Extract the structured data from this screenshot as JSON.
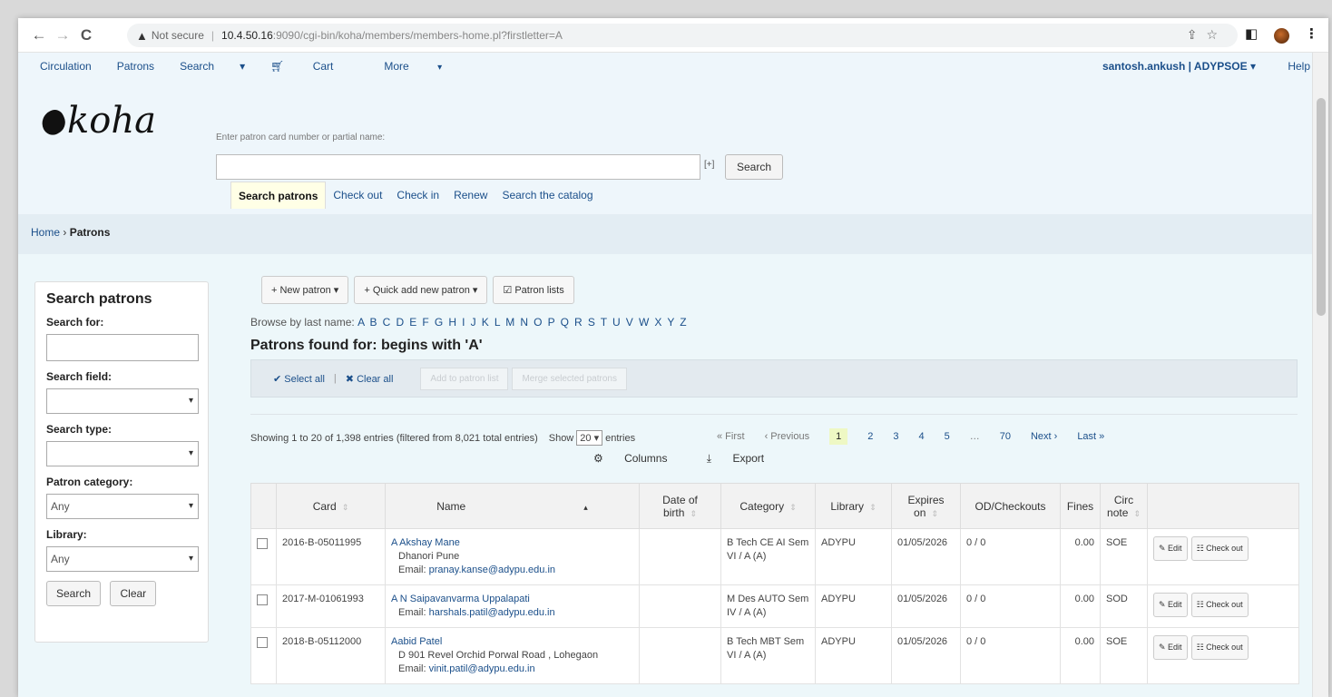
{
  "browser": {
    "security": "Not secure",
    "host": "10.4.50.16",
    "path": ":9090/cgi-bin/koha/members/members-home.pl?firstletter=A"
  },
  "topnav": {
    "items": [
      "Circulation",
      "Patrons",
      "Search",
      "Cart",
      "More"
    ],
    "user": "santosh.ankush",
    "branch": "ADYPSOE",
    "help": "Help"
  },
  "logo": "koha",
  "search": {
    "label": "Enter patron card number or partial name:",
    "plus": "[+]",
    "button": "Search",
    "tabs": [
      "Search patrons",
      "Check out",
      "Check in",
      "Renew",
      "Search the catalog"
    ]
  },
  "breadcrumb": {
    "home": "Home",
    "current": "Patrons"
  },
  "sidebar": {
    "title": "Search patrons",
    "search_for": "Search for:",
    "search_field": "Search field:",
    "search_type": "Search type:",
    "patron_category": "Patron category:",
    "category_value": "Any",
    "library": "Library:",
    "library_value": "Any",
    "search_btn": "Search",
    "clear_btn": "Clear"
  },
  "toolbar": {
    "new_patron": "New patron",
    "quick_add": "Quick add new patron",
    "patron_lists": "Patron lists"
  },
  "browse": {
    "label": "Browse by last name:",
    "letters": "A B C D E F G H I J K L M N O P Q R S T U V W X Y Z"
  },
  "found_title": "Patrons found for: begins with 'A'",
  "selection": {
    "select_all": "Select all",
    "clear_all": "Clear all",
    "add_to_list": "Add to patron list",
    "merge": "Merge selected patrons"
  },
  "listing": {
    "showing": "Showing 1 to 20 of 1,398 entries (filtered from 8,021 total entries)",
    "show": "Show",
    "per_page": "20",
    "entries": "entries",
    "first": "« First",
    "previous": "‹ Previous",
    "pages": [
      "1",
      "2",
      "3",
      "4",
      "5",
      "…",
      "70"
    ],
    "next": "Next ›",
    "last": "Last »",
    "columns": "Columns",
    "export": "Export"
  },
  "table": {
    "headers": [
      "Card",
      "Name",
      "Date of birth",
      "Category",
      "Library",
      "Expires on",
      "OD/Checkouts",
      "Fines",
      "Circ note"
    ],
    "edit": "Edit",
    "checkout": "Check out",
    "rows": [
      {
        "card": "2016-B-05011995",
        "name": "A Akshay Mane",
        "addr": "Dhanori Pune",
        "email_label": "Email:",
        "email": "pranay.kanse@adypu.edu.in",
        "dob": "",
        "category": "B Tech CE AI Sem VI / A (A)",
        "library": "ADYPU",
        "expires": "01/05/2026",
        "od": "0 / 0",
        "fines": "0.00",
        "note": "SOE"
      },
      {
        "card": "2017-M-01061993",
        "name": "A N Saipavanvarma Uppalapati",
        "addr": "",
        "email_label": "Email:",
        "email": "harshals.patil@adypu.edu.in",
        "dob": "",
        "category": "M Des AUTO Sem IV / A (A)",
        "library": "ADYPU",
        "expires": "01/05/2026",
        "od": "0 / 0",
        "fines": "0.00",
        "note": "SOD"
      },
      {
        "card": "2018-B-05112000",
        "name": "Aabid Patel",
        "addr": "D 901 Revel Orchid Porwal Road , Lohegaon",
        "email_label": "Email:",
        "email": "vinit.patil@adypu.edu.in",
        "dob": "",
        "category": "B Tech MBT Sem VI / A (A)",
        "library": "ADYPU",
        "expires": "01/05/2026",
        "od": "0 / 0",
        "fines": "0.00",
        "note": "SOE"
      }
    ]
  }
}
